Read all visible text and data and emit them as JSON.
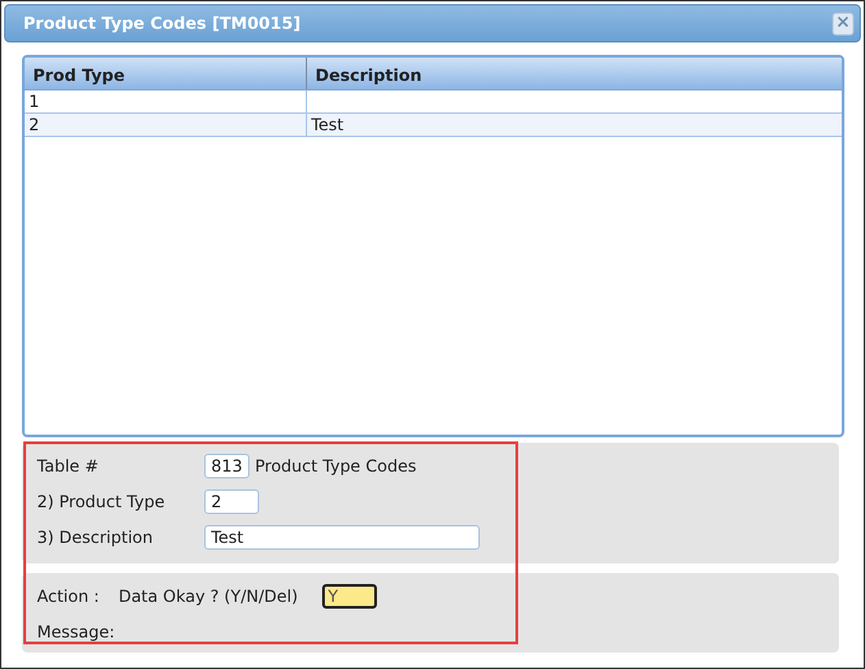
{
  "window": {
    "title": "Product Type Codes [TM0015]",
    "close_symbol": "×"
  },
  "table": {
    "columns": [
      "Prod Type",
      "Description"
    ],
    "rows": [
      {
        "cells": [
          "1",
          ""
        ],
        "selected": false
      },
      {
        "cells": [
          "2",
          "Test"
        ],
        "selected": true
      }
    ]
  },
  "form": {
    "fields": [
      {
        "label": "Table #",
        "value": "813",
        "kind": "small",
        "suffix": "Product Type Codes"
      },
      {
        "label": "2) Product Type",
        "value": "2",
        "kind": "medium"
      },
      {
        "label": "3) Description",
        "value": "Test",
        "kind": "large"
      }
    ]
  },
  "action": {
    "label": "Action :",
    "prompt": "Data Okay ? (Y/N/Del)",
    "value": "Y",
    "message_label": "Message:"
  },
  "annotation": {
    "kind": "highlight-box"
  }
}
